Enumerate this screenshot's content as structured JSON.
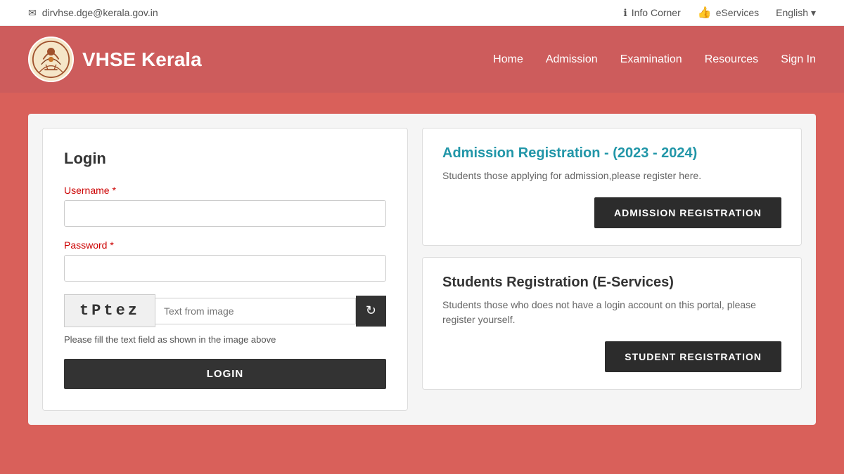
{
  "topbar": {
    "email": "dirvhse.dge@kerala.gov.in",
    "info_corner": "Info Corner",
    "eservices": "eServices",
    "language": "English ▾"
  },
  "header": {
    "site_name": "VHSE Kerala",
    "nav": {
      "home": "Home",
      "admission": "Admission",
      "examination": "Examination",
      "resources": "Resources",
      "sign_in": "Sign In"
    }
  },
  "login": {
    "title": "Login",
    "username_label": "Username",
    "username_required": "*",
    "password_label": "Password",
    "password_required": "*",
    "captcha_text": "tPtez",
    "captcha_placeholder": "Text from image",
    "captcha_hint": "Please fill the text field as shown in the image above",
    "login_button": "LOGIN"
  },
  "admission": {
    "title": "Admission Registration - ",
    "year_span": "(2023 - 2024)",
    "description": "Students those applying for admission,please register here.",
    "button": "ADMISSION REGISTRATION"
  },
  "students_reg": {
    "title": "Students Registration (E-Services)",
    "description": "Students those who does not have a login account on this portal, please register yourself.",
    "button": "STUDENT REGISTRATION"
  }
}
